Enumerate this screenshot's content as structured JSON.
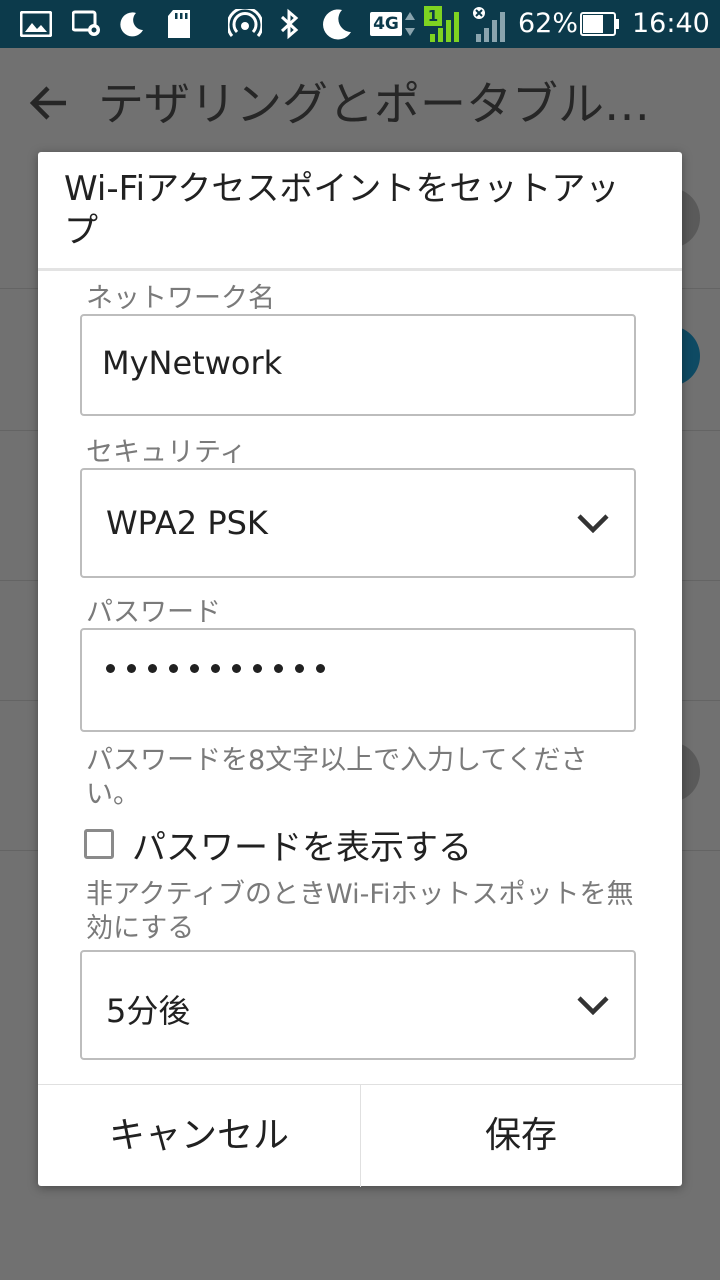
{
  "status_bar": {
    "battery_percent": "62%",
    "time": "16:40",
    "network_type": "4G",
    "sim_slot": "1"
  },
  "background": {
    "app_bar_title": "テザリングとポータブル…"
  },
  "dialog": {
    "title": "Wi-Fiアクセスポイントをセットアップ",
    "network_name_label": "ネットワーク名",
    "network_name_value": "MyNetwork",
    "security_label": "セキュリティ",
    "security_value": "WPA2 PSK",
    "password_label": "パスワード",
    "password_masked_length": 11,
    "password_hint": "パスワードを8文字以上で入力してください。",
    "show_password_label": "パスワードを表示する",
    "show_password_checked": false,
    "timeout_label": "非アクティブのときWi-Fiホットスポットを無効にする",
    "timeout_value": "5分後",
    "cancel_label": "キャンセル",
    "save_label": "保存"
  }
}
